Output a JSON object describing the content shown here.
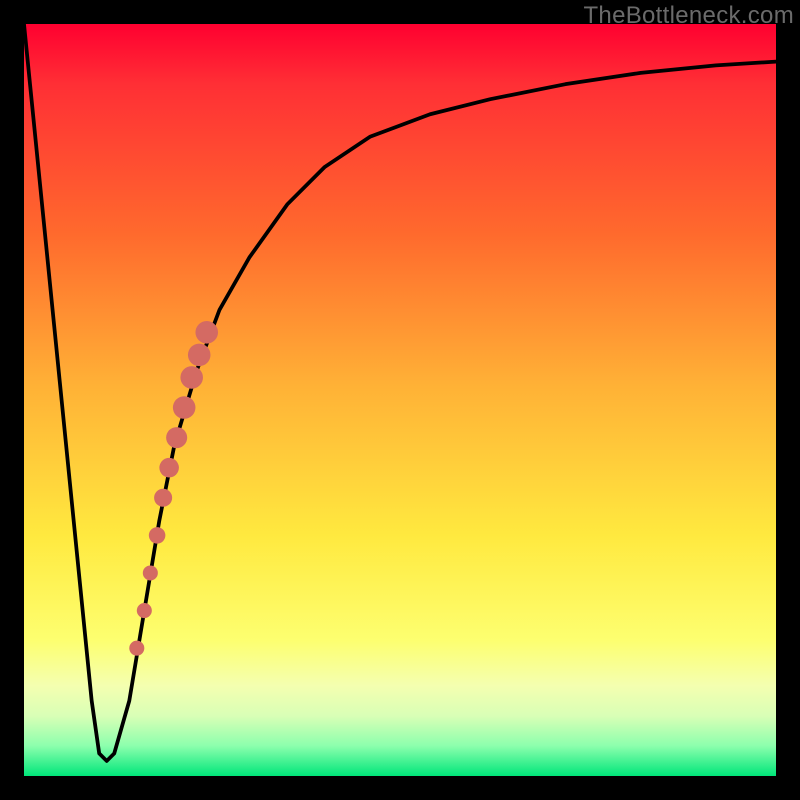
{
  "watermark": {
    "text": "TheBottleneck.com"
  },
  "colors": {
    "curve_stroke": "#000000",
    "marker_fill": "#d46a63",
    "gradient": [
      "#ff0030",
      "#ff2f35",
      "#ff6a2d",
      "#ffb136",
      "#ffe93f",
      "#fdff70",
      "#f4ffb0",
      "#d9ffb6",
      "#8cffad",
      "#00e67a"
    ]
  },
  "chart_data": {
    "type": "line",
    "title": "",
    "xlabel": "",
    "ylabel": "",
    "xlim": [
      0,
      100
    ],
    "ylim": [
      0,
      100
    ],
    "series": [
      {
        "name": "bottleneck-curve",
        "x": [
          0,
          4,
          7,
          9,
          10,
          11,
          12,
          14,
          16,
          18,
          20,
          23,
          26,
          30,
          35,
          40,
          46,
          54,
          62,
          72,
          82,
          92,
          100
        ],
        "y": [
          100,
          60,
          30,
          10,
          3,
          2,
          3,
          10,
          22,
          34,
          44,
          54,
          62,
          69,
          76,
          81,
          85,
          88,
          90,
          92,
          93.5,
          94.5,
          95
        ]
      }
    ],
    "markers": {
      "name": "highlighted-segment",
      "shape": "circle",
      "points": [
        {
          "x": 15.0,
          "y": 17,
          "r": 1.0
        },
        {
          "x": 16.0,
          "y": 22,
          "r": 1.0
        },
        {
          "x": 16.8,
          "y": 27,
          "r": 1.0
        },
        {
          "x": 17.7,
          "y": 32,
          "r": 1.1
        },
        {
          "x": 18.5,
          "y": 37,
          "r": 1.2
        },
        {
          "x": 19.3,
          "y": 41,
          "r": 1.3
        },
        {
          "x": 20.3,
          "y": 45,
          "r": 1.4
        },
        {
          "x": 21.3,
          "y": 49,
          "r": 1.5
        },
        {
          "x": 22.3,
          "y": 53,
          "r": 1.5
        },
        {
          "x": 23.3,
          "y": 56,
          "r": 1.5
        },
        {
          "x": 24.3,
          "y": 59,
          "r": 1.5
        }
      ]
    }
  }
}
